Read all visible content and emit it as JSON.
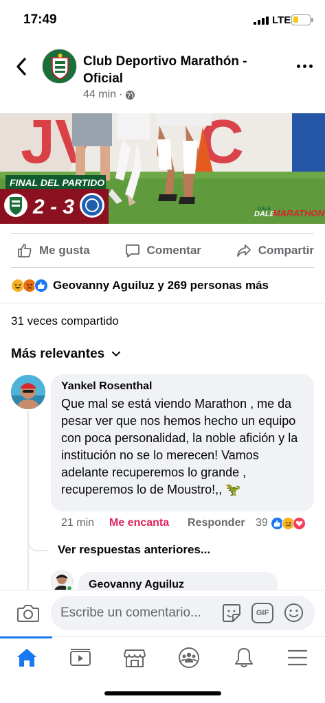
{
  "status_bar": {
    "time": "17:49",
    "network": "LTE",
    "battery_level": 0.3,
    "battery_color": "#f5c518"
  },
  "post": {
    "page_name": "Club Deportivo Marathón - Oficial",
    "time_ago": "44 min",
    "separator": "·",
    "audience_icon": "globe-icon",
    "image": {
      "banner_title": "FINAL DEL PARTIDO",
      "score": "2 - 3",
      "brand_small": "DALE",
      "brand": "DALE",
      "brand_team": "MARATHON",
      "away_badge_text": "C.D. VICTORIA"
    },
    "actions": {
      "like_label": "Me gusta",
      "comment_label": "Comentar",
      "share_label": "Compartir"
    },
    "reactions": {
      "icons": [
        "haha-reaction",
        "angry-reaction",
        "like-reaction"
      ],
      "summary": "Geovanny Aguiluz y 269 personas más"
    },
    "shares_text": "31 veces compartido"
  },
  "comments": {
    "sort_label": "Más relevantes",
    "items": [
      {
        "author": "Yankel Rosenthal",
        "text": "Que mal se está viendo Marathon , me da pesar ver que nos hemos hecho un equipo con poca personalidad, la noble afición y la institución no se lo merecen! Vamos adelante recuperemos lo grande , recuperemos lo de Moustro!,, 🦖",
        "time": "21 min",
        "reaction_label": "Me encanta",
        "reply_label": "Responder",
        "reaction_count": "39",
        "reaction_icons": [
          "like-reaction",
          "sad-reaction",
          "love-reaction"
        ]
      }
    ],
    "earlier_replies_label": "Ver respuestas anteriores...",
    "reply_preview_author": "Geovanny Aguiluz"
  },
  "composer": {
    "placeholder": "Escribe un comentario...",
    "gif_label": "GIF"
  },
  "nav": {
    "items": [
      "home-icon",
      "watch-icon",
      "marketplace-icon",
      "groups-icon",
      "notifications-icon",
      "menu-icon"
    ],
    "active_color": "#1877f2"
  },
  "colors": {
    "accent": "#1877f2",
    "love": "#e0245e",
    "secondary_text": "#65676b",
    "bubble": "#f0f2f5"
  }
}
